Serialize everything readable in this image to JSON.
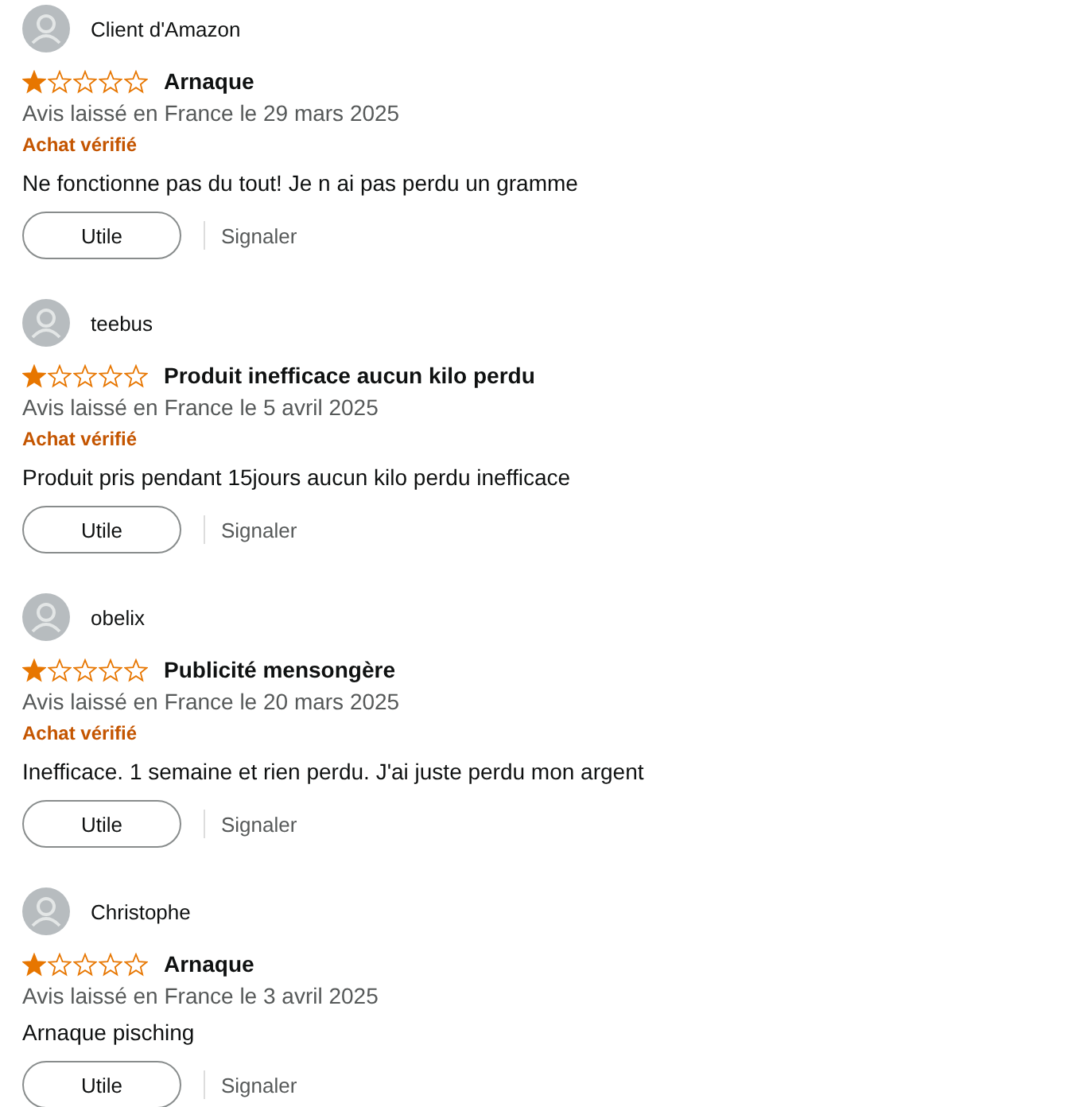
{
  "reviews": [
    {
      "author": "Client d'Amazon",
      "stars": 1,
      "title": "Arnaque",
      "date": "Avis laissé en France le 29 mars 2025",
      "verified": true,
      "verified_label": "Achat vérifié",
      "body": "Ne fonctionne pas du tout! Je n ai pas perdu un gramme",
      "helpful": "Utile",
      "report": "Signaler"
    },
    {
      "author": "teebus",
      "stars": 1,
      "title": "Produit inefficace aucun kilo perdu",
      "date": "Avis laissé en France le 5 avril 2025",
      "verified": true,
      "verified_label": "Achat vérifié",
      "body": "Produit pris pendant 15jours aucun kilo perdu inefficace",
      "helpful": "Utile",
      "report": "Signaler"
    },
    {
      "author": "obelix",
      "stars": 1,
      "title": "Publicité mensongère",
      "date": "Avis laissé en France le 20 mars 2025",
      "verified": true,
      "verified_label": "Achat vérifié",
      "body": "Inefficace. 1 semaine et rien perdu. J'ai juste perdu mon argent",
      "helpful": "Utile",
      "report": "Signaler"
    },
    {
      "author": "Christophe",
      "stars": 1,
      "title": "Arnaque",
      "date": "Avis laissé en France le 3 avril 2025",
      "verified": false,
      "body": "Arnaque pisching",
      "helpful": "Utile",
      "report": "Signaler"
    }
  ]
}
